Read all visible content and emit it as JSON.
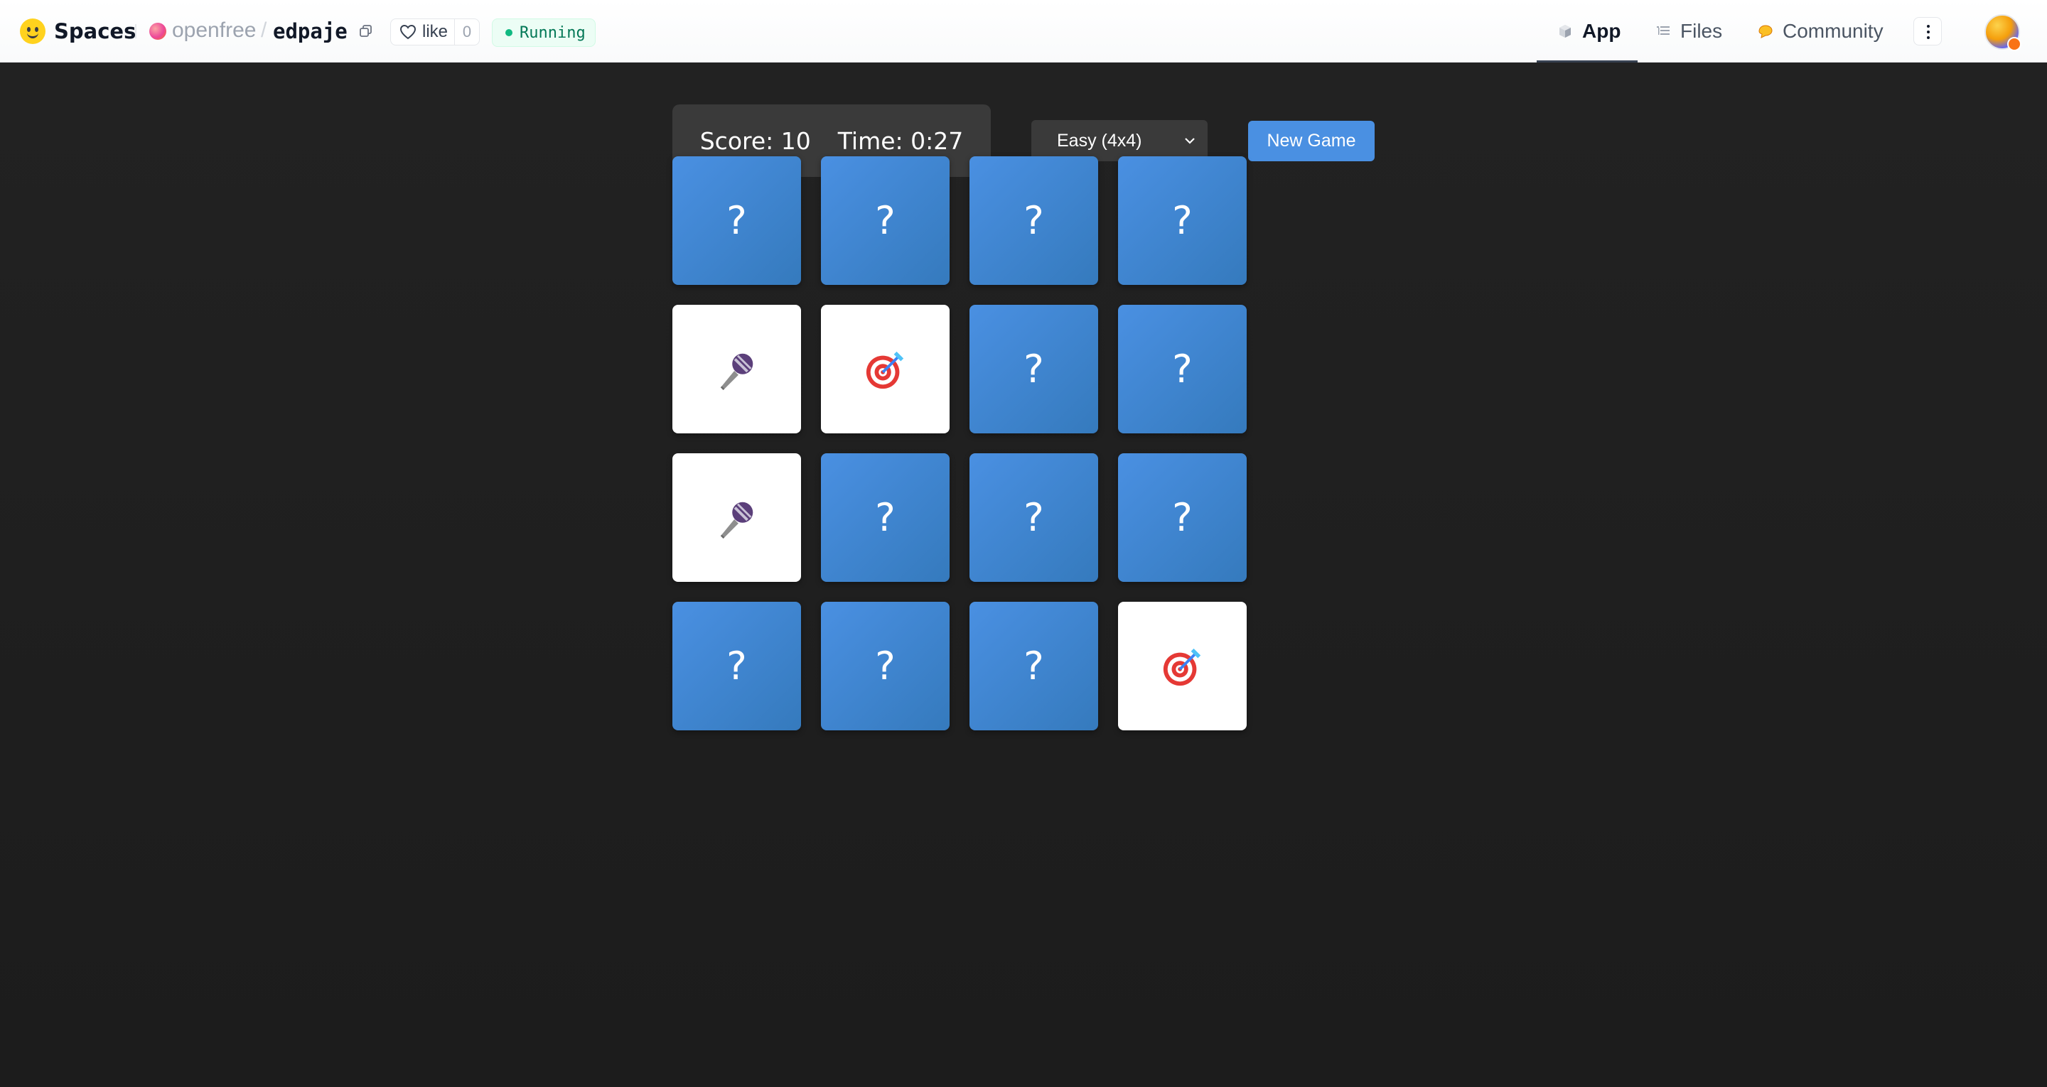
{
  "header": {
    "brand": "Spaces",
    "owner": "openfree",
    "separator": "/",
    "repo": "edpaje",
    "like_label": "like",
    "like_count": "0",
    "status": "Running",
    "tabs": [
      {
        "label": "App",
        "icon": "app-cube-icon",
        "active": true
      },
      {
        "label": "Files",
        "icon": "files-icon",
        "active": false
      },
      {
        "label": "Community",
        "icon": "community-icon",
        "active": false
      }
    ],
    "colors": {
      "status_green": "#10b981",
      "brand_yellow": "#ffd21e"
    }
  },
  "game": {
    "score_label": "Score: 10",
    "time_label": "Time: 0:27",
    "difficulty": "Easy (4x4)",
    "new_game_label": "New Game",
    "hidden_symbol": "?",
    "colors": {
      "card_back": "#4a90e2",
      "card_front": "#ffffff",
      "background": "#1f1f1f",
      "panel": "#3a3a3a"
    },
    "cards": [
      {
        "state": "hidden",
        "symbol": "?"
      },
      {
        "state": "hidden",
        "symbol": "?"
      },
      {
        "state": "hidden",
        "symbol": "?"
      },
      {
        "state": "hidden",
        "symbol": "?"
      },
      {
        "state": "flipped",
        "symbol": "microphone-emoji"
      },
      {
        "state": "flipped",
        "symbol": "dart-target-emoji"
      },
      {
        "state": "hidden",
        "symbol": "?"
      },
      {
        "state": "hidden",
        "symbol": "?"
      },
      {
        "state": "flipped",
        "symbol": "microphone-emoji"
      },
      {
        "state": "hidden",
        "symbol": "?"
      },
      {
        "state": "hidden",
        "symbol": "?"
      },
      {
        "state": "hidden",
        "symbol": "?"
      },
      {
        "state": "hidden",
        "symbol": "?"
      },
      {
        "state": "hidden",
        "symbol": "?"
      },
      {
        "state": "hidden",
        "symbol": "?"
      },
      {
        "state": "flipped",
        "symbol": "dart-target-emoji"
      }
    ]
  }
}
